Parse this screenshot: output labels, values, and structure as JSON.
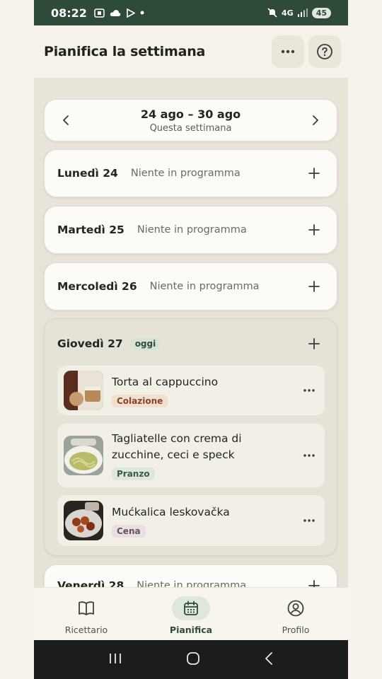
{
  "status_bar": {
    "time": "08:22",
    "network": "4G",
    "battery": "45"
  },
  "header": {
    "title": "Pianifica la settimana"
  },
  "week": {
    "range": "24 ago – 30 ago",
    "label": "Questa settimana"
  },
  "days": [
    {
      "name": "Lunedì 24",
      "status": "Niente in programma"
    },
    {
      "name": "Martedì 25",
      "status": "Niente in programma"
    },
    {
      "name": "Mercoledì 26",
      "status": "Niente in programma"
    }
  ],
  "today": {
    "name": "Giovedì 27",
    "badge": "oggi",
    "meals": [
      {
        "name": "Torta al cappuccino",
        "tag": "Colazione"
      },
      {
        "name": "Tagliatelle con crema di zucchine, ceci e speck",
        "tag": "Pranzo"
      },
      {
        "name": "Mućkalica leskovačka",
        "tag": "Cena"
      }
    ]
  },
  "next_day": {
    "name": "Venerdì 28",
    "status": "Niente in programma"
  },
  "bottom_nav": [
    {
      "label": "Ricettario",
      "icon": "book-icon"
    },
    {
      "label": "Pianifica",
      "icon": "calendar-icon",
      "active": true
    },
    {
      "label": "Profilo",
      "icon": "profile-icon"
    }
  ],
  "colors": {
    "brand": "#2e4a38",
    "background": "#ede8de",
    "card": "#fdfbf7"
  }
}
